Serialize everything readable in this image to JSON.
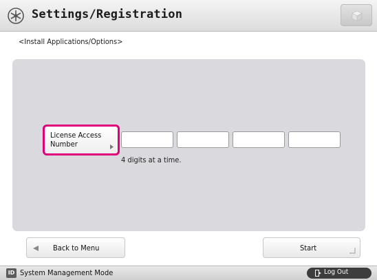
{
  "header": {
    "title": "Settings/Registration",
    "title_icon": "settings-wheel-icon",
    "top_button_icon": "cube-icon"
  },
  "breadcrumb": "<Install Applications/Options>",
  "license": {
    "button_label_line1": "License Access",
    "button_label_line2": "Number",
    "fields": [
      "",
      "",
      "",
      ""
    ],
    "hint": "4 digits at a time."
  },
  "footer": {
    "back_label": "Back to Menu",
    "start_label": "Start"
  },
  "status": {
    "mode_icon": "ID",
    "mode_text": "System Management Mode",
    "logout_label": "Log Out"
  },
  "colors": {
    "accent": "#e0007a",
    "panel": "#d9d9de"
  }
}
